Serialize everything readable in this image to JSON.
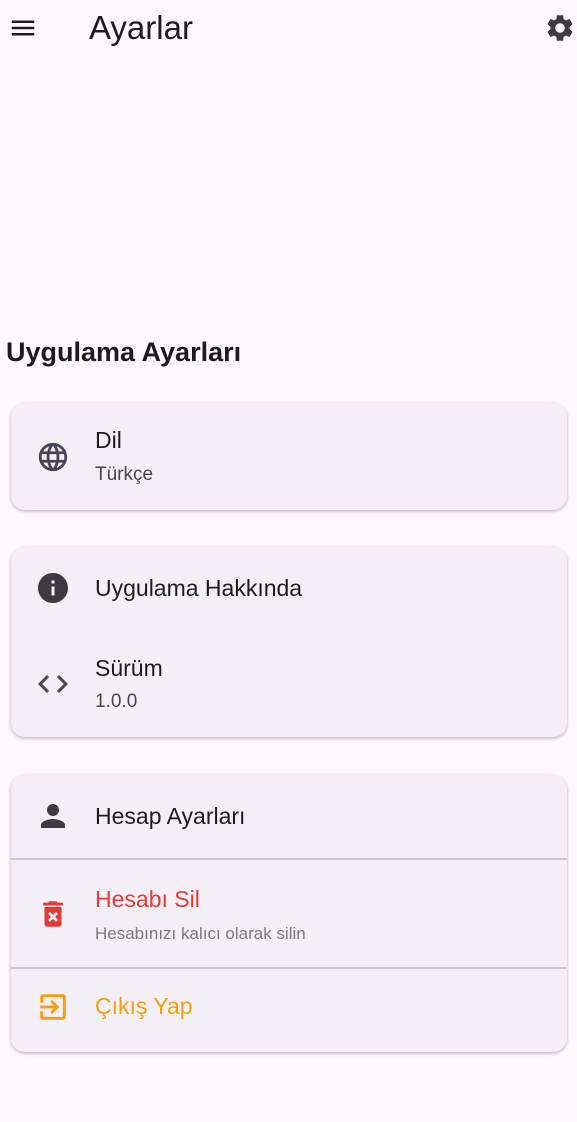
{
  "colors": {
    "background": "#fef7fe",
    "card": "#f4eff6",
    "danger": "#e53935",
    "warning": "#f59e0b",
    "icon": "#4a4458",
    "divider": "#cac4d0"
  },
  "app_bar": {
    "title": "Ayarlar",
    "menu_icon": "hamburger-menu-icon",
    "settings_icon": "gear-icon"
  },
  "section": {
    "title": "Uygulama Ayarları"
  },
  "language_card": {
    "icon": "globe-icon",
    "title": "Dil",
    "subtitle": "Türkçe"
  },
  "about_card": {
    "about": {
      "icon": "info-icon",
      "title": "Uygulama Hakkında"
    },
    "version": {
      "icon": "code-icon",
      "title": "Sürüm",
      "subtitle": "1.0.0"
    }
  },
  "account_card": {
    "account_settings": {
      "icon": "person-icon",
      "title": "Hesap Ayarları"
    },
    "delete_account": {
      "icon": "delete-forever-icon",
      "title": "Hesabı Sil",
      "subtitle": "Hesabınızı kalıcı olarak silin"
    },
    "logout": {
      "icon": "logout-icon",
      "title": "Çıkış Yap"
    }
  }
}
